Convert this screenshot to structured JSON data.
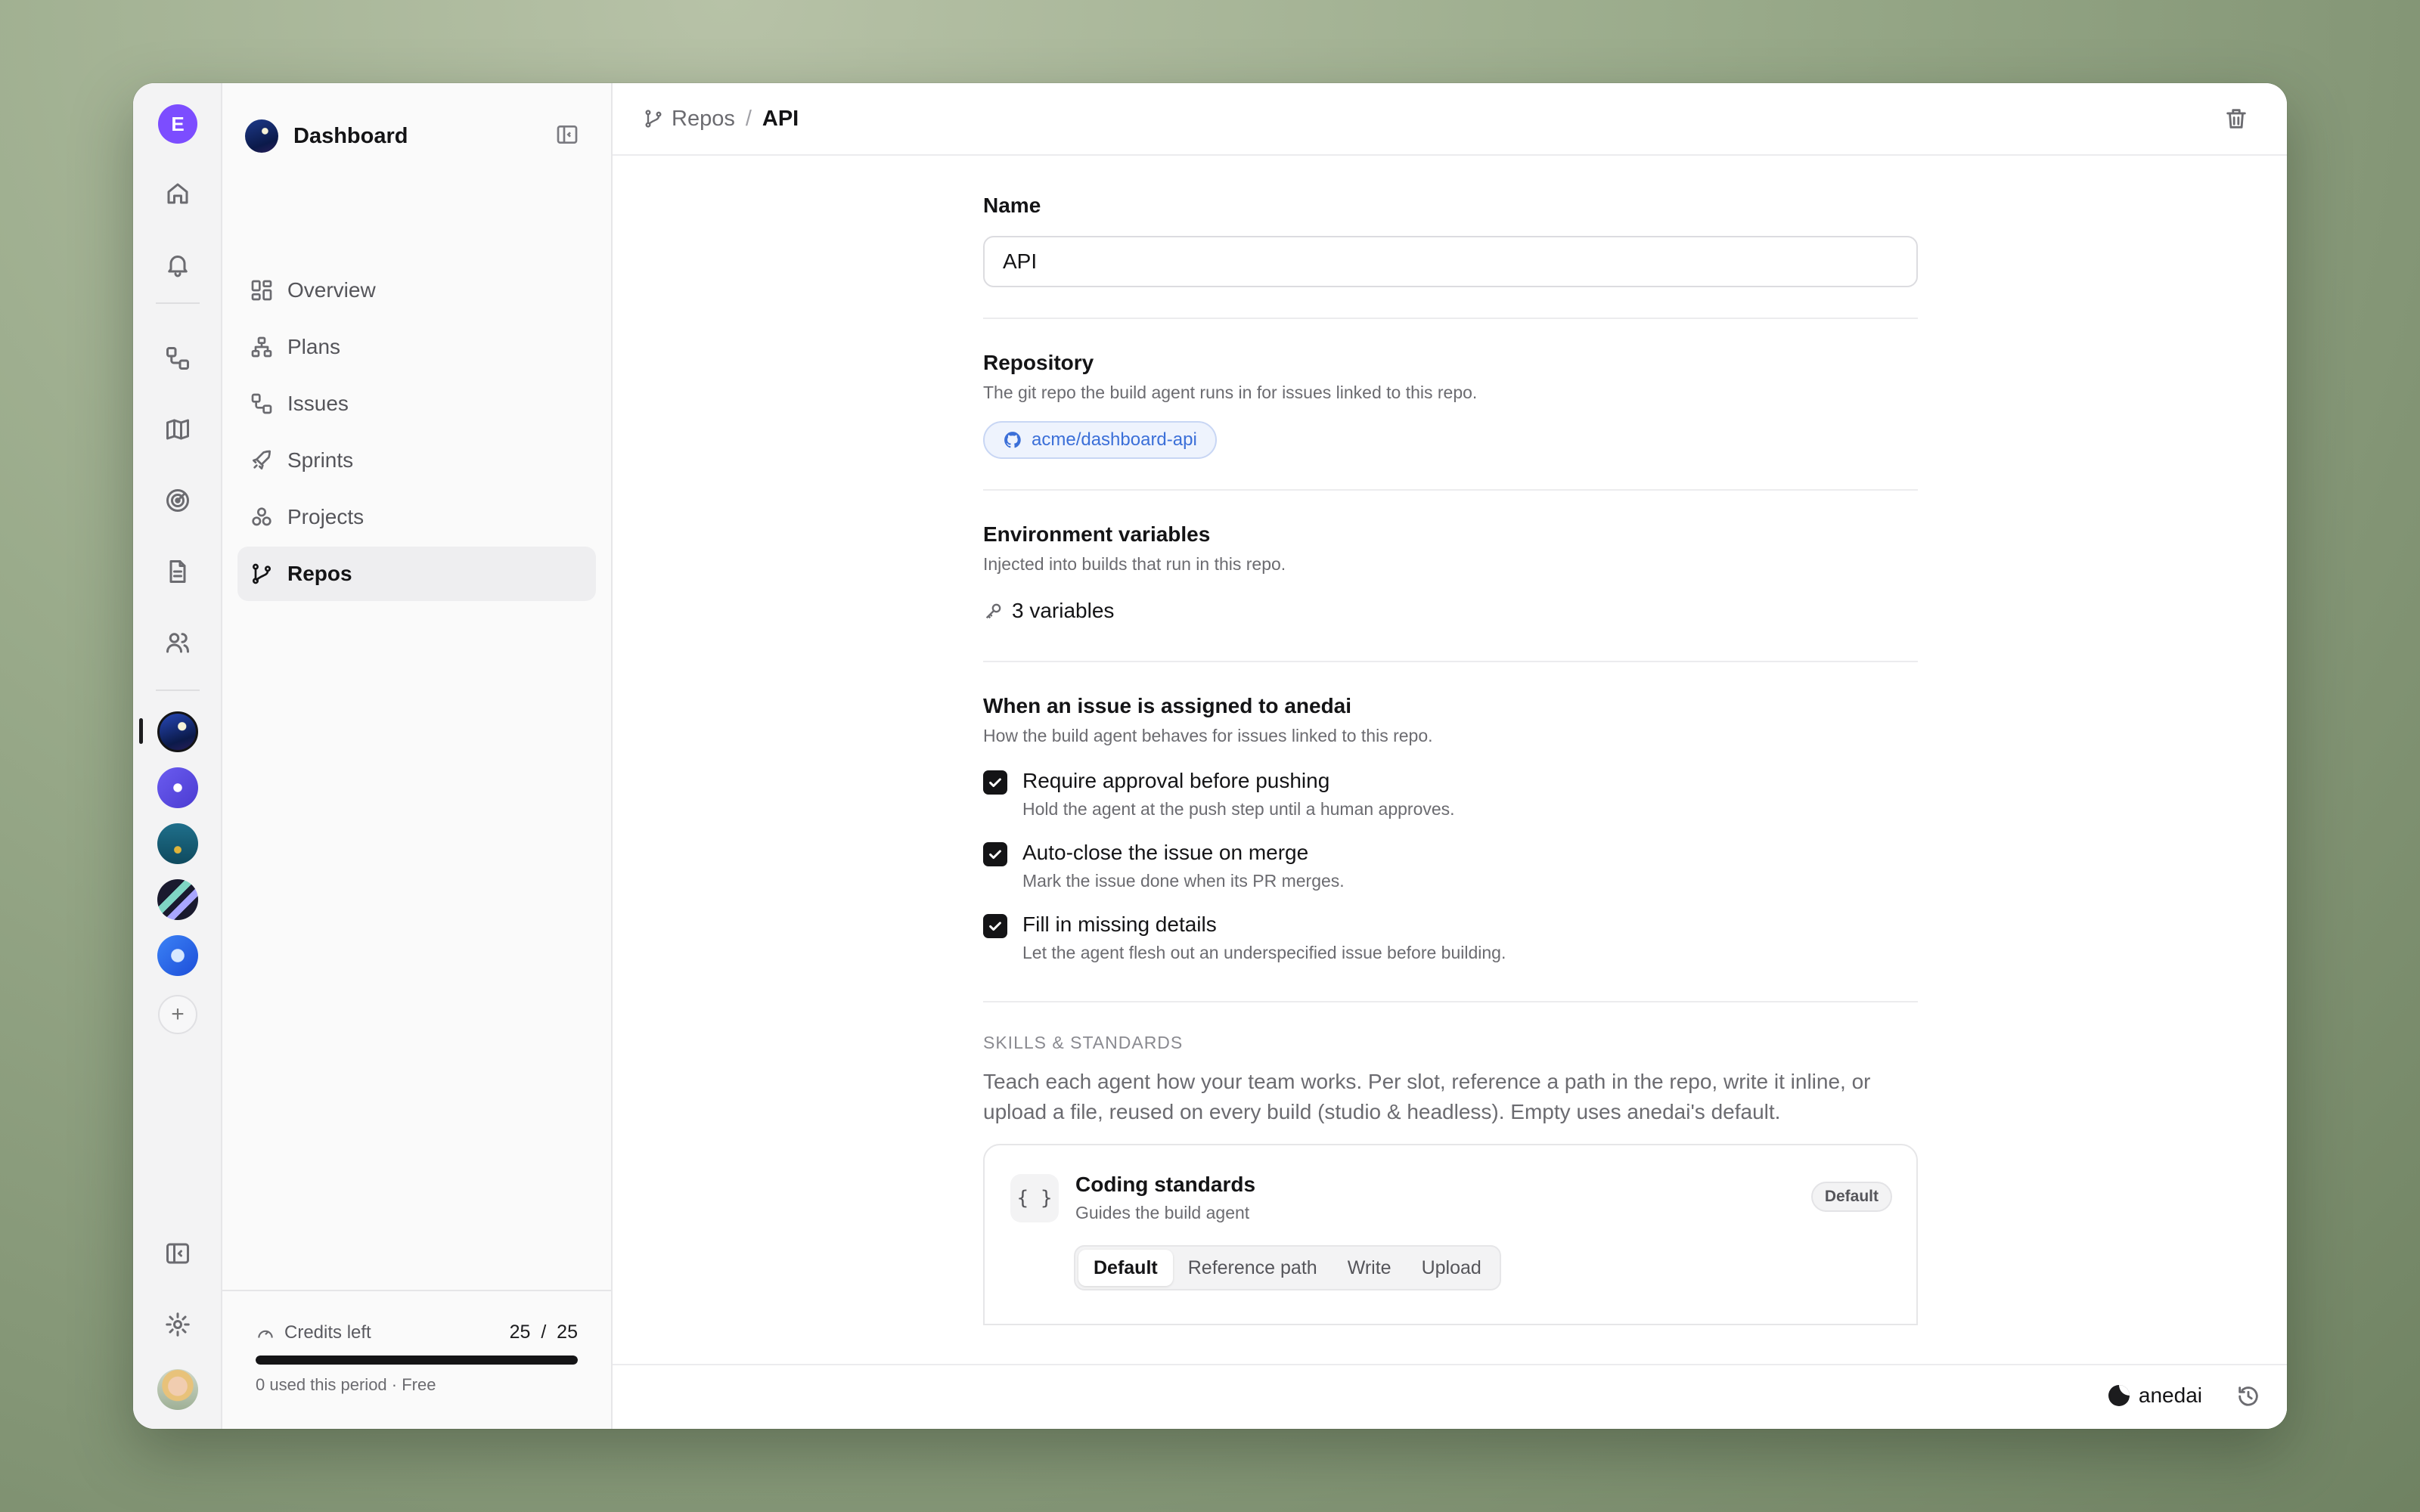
{
  "rail": {
    "user_initial": "E",
    "icons": [
      "home-icon",
      "bell-icon",
      "issues-icon",
      "map-icon",
      "radar-icon",
      "document-icon",
      "users-icon"
    ],
    "workspaces": [
      "workspace-dashboard",
      "workspace-planet",
      "workspace-forest",
      "workspace-stripes",
      "workspace-cube"
    ]
  },
  "sidebar": {
    "title": "Dashboard",
    "items": [
      {
        "label": "Overview",
        "icon": "grid-icon"
      },
      {
        "label": "Plans",
        "icon": "hierarchy-icon"
      },
      {
        "label": "Issues",
        "icon": "issues-icon"
      },
      {
        "label": "Sprints",
        "icon": "rocket-icon"
      },
      {
        "label": "Projects",
        "icon": "projects-icon"
      },
      {
        "label": "Repos",
        "icon": "git-branch-icon",
        "active": true
      }
    ],
    "credits": {
      "label": "Credits left",
      "value": "25  /  25",
      "remaining_fraction": 1.0,
      "sub": "0 used this period · Free"
    }
  },
  "breadcrumb": {
    "parent": "Repos",
    "separator": "/",
    "current": "API"
  },
  "form": {
    "name": {
      "label": "Name",
      "value": "API"
    },
    "repository": {
      "label": "Repository",
      "desc": "The git repo the build agent runs in for issues linked to this repo.",
      "repo": "acme/dashboard-api"
    },
    "env": {
      "label": "Environment variables",
      "desc": "Injected into builds that run in this repo.",
      "count": "3 variables"
    },
    "assigned": {
      "label": "When an issue is assigned to anedai",
      "desc": "How the build agent behaves for issues linked to this repo.",
      "options": [
        {
          "title": "Require approval before pushing",
          "desc": "Hold the agent at the push step until a human approves.",
          "checked": true
        },
        {
          "title": "Auto-close the issue on merge",
          "desc": "Mark the issue done when its PR merges.",
          "checked": true
        },
        {
          "title": "Fill in missing details",
          "desc": "Let the agent flesh out an underspecified issue before building.",
          "checked": true
        }
      ]
    },
    "skills": {
      "title": "SKILLS & STANDARDS",
      "desc": "Teach each agent how your team works. Per slot, reference a path in the repo, write it inline, or upload a file, reused on every build (studio & headless). Empty uses anedai's default.",
      "card": {
        "icon_text": "{ }",
        "title": "Coding standards",
        "sub": "Guides the build agent",
        "badge": "Default",
        "tabs": [
          "Default",
          "Reference path",
          "Write",
          "Upload"
        ],
        "active_tab": "Default"
      }
    }
  },
  "footer": {
    "agent_name": "anedai"
  }
}
